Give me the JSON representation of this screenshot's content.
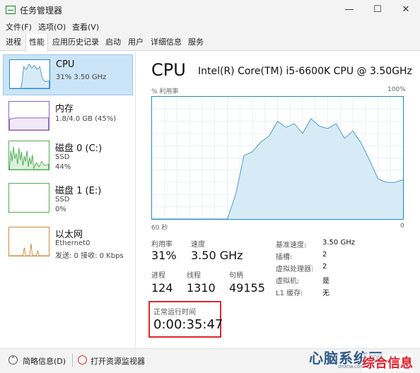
{
  "window": {
    "title": "任务管理器",
    "minimize": "—",
    "maximize": "☐",
    "close": "✕"
  },
  "menu": [
    "文件(F)",
    "选项(O)",
    "查看(V)"
  ],
  "tabs": [
    "进程",
    "性能",
    "应用历史记录",
    "启动",
    "用户",
    "详细信息",
    "服务"
  ],
  "active_tab": "性能",
  "sidebar": {
    "cpu": {
      "name": "CPU",
      "sub1": "31% 3.50 GHz"
    },
    "memory": {
      "name": "内存",
      "sub1": "1.8/4.0 GB (45%)"
    },
    "disk0": {
      "name": "磁盘 0 (C:)",
      "sub1": "SSD",
      "sub2": "44%"
    },
    "disk1": {
      "name": "磁盘 1 (E:)",
      "sub1": "SSD",
      "sub2": "0%"
    },
    "ethernet": {
      "name": "以太网",
      "sub1": "Ethernet0",
      "sub2": "发送: 0 接收: 0 Kbps"
    }
  },
  "main": {
    "title": "CPU",
    "model": "Intel(R) Core(TM) i5-6600K CPU @ 3.50GHz",
    "util_label": "% 利用率",
    "util_max": "100%",
    "x_left": "60 秒",
    "x_right": "0"
  },
  "stats": {
    "util_label": "利用率",
    "util_value": "31%",
    "speed_label": "速度",
    "speed_value": "3.50 GHz",
    "proc_label": "进程",
    "proc_value": "124",
    "threads_label": "线程",
    "threads_value": "1310",
    "handles_label": "句柄",
    "handles_value": "49155"
  },
  "specs": [
    {
      "label": "基准速度:",
      "value": "3.50 GHz"
    },
    {
      "label": "插槽:",
      "value": "2"
    },
    {
      "label": "虚拟处理器:",
      "value": "2"
    },
    {
      "label": "虚拟机:",
      "value": "是"
    },
    {
      "label": "L1 缓存:",
      "value": "无"
    }
  ],
  "uptime": {
    "label": "正常运行时间",
    "value": "0:00:35:47"
  },
  "footer": {
    "fewer": "简略信息(D)",
    "resmon": "打开资源监视器"
  },
  "watermark": {
    "brand": "心脑系统网",
    "sub": "dnxtw.com",
    "badge": "综合信息"
  },
  "colors": {
    "graph_line": "#4a9bc9",
    "graph_fill": "#d7ebf7",
    "disk_green": "#4caf50",
    "eth_orange": "#d08a3a",
    "mem_purple": "#8b5fbf",
    "highlight_red": "#e0262d"
  },
  "chart_data": {
    "type": "area",
    "x": [
      60,
      58,
      56,
      54,
      52,
      50,
      48,
      46,
      44,
      42,
      40,
      38,
      36,
      34,
      32,
      30,
      28,
      26,
      24,
      22,
      20,
      18,
      16,
      14,
      12,
      10,
      8,
      6,
      4,
      2,
      0
    ],
    "values": [
      0,
      0,
      0,
      0,
      0,
      0,
      0,
      0,
      0,
      0,
      20,
      52,
      55,
      63,
      68,
      80,
      75,
      78,
      70,
      82,
      76,
      74,
      78,
      66,
      72,
      62,
      48,
      33,
      30,
      30,
      32
    ],
    "ylim": [
      0,
      100
    ],
    "grid": true
  }
}
